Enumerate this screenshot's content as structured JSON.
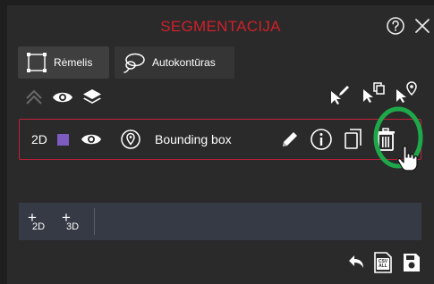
{
  "panel": {
    "title": "SEGMENTACIJA",
    "help_icon": "question-circle-icon",
    "close_icon": "close-icon"
  },
  "tabs": [
    {
      "label": "Rėmelis",
      "icon": "bounding-box-icon",
      "active": true
    },
    {
      "label": "Autokontūras",
      "icon": "lasso-icon",
      "active": false
    }
  ],
  "toolbar": {
    "collapse_icon": "chevron-up-icon",
    "visibility_icon": "eye-icon",
    "layers_icon": "layers-icon",
    "pointer_edit_icon": "cursor-pencil-icon",
    "pointer_copy_icon": "cursor-copy-icon",
    "pointer_pin_icon": "cursor-pin-icon"
  },
  "annotation": {
    "dimension": "2D",
    "color": "#7c5cbf",
    "label": "Bounding box",
    "icons": [
      "eye-icon",
      "location-pin-icon",
      "pencil-icon",
      "info-icon",
      "copy-icon",
      "trash-icon"
    ]
  },
  "add_buttons": [
    {
      "plus": "+",
      "label": "2D"
    },
    {
      "plus": "+",
      "label": "3D"
    }
  ],
  "footer": {
    "undo_icon": "undo-icon",
    "csv_icon": "csv-all-icon",
    "save_icon": "save-icon",
    "csv_label": "CSV ALL"
  },
  "highlight_color": "#1ea84a"
}
